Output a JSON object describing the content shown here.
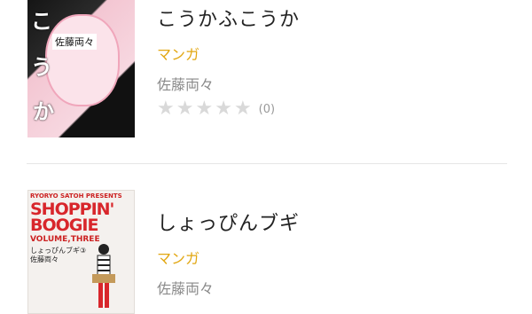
{
  "items": [
    {
      "title": "こうかふこうか",
      "category": "マンガ",
      "author": "佐藤両々",
      "rating_count": "(0)",
      "cover": {
        "title_chars": [
          "こ",
          "う",
          "か"
        ],
        "author_tag": "佐藤両々"
      }
    },
    {
      "title": "しょっぴんブギ",
      "category": "マンガ",
      "author": "佐藤両々",
      "cover": {
        "header": "RYORYO SATOH PRESENTS",
        "logo_line1": "SHOPPIN'",
        "logo_line2": "BOOGIE",
        "volume": "VOLUME,THREE",
        "subtitle": "しょっぴんブギ③",
        "author": "佐藤両々"
      }
    }
  ],
  "colors": {
    "category": "#e2a712",
    "author": "#8a8a8a",
    "star_empty": "#d9d9d9",
    "divider": "#e6e6e6"
  }
}
